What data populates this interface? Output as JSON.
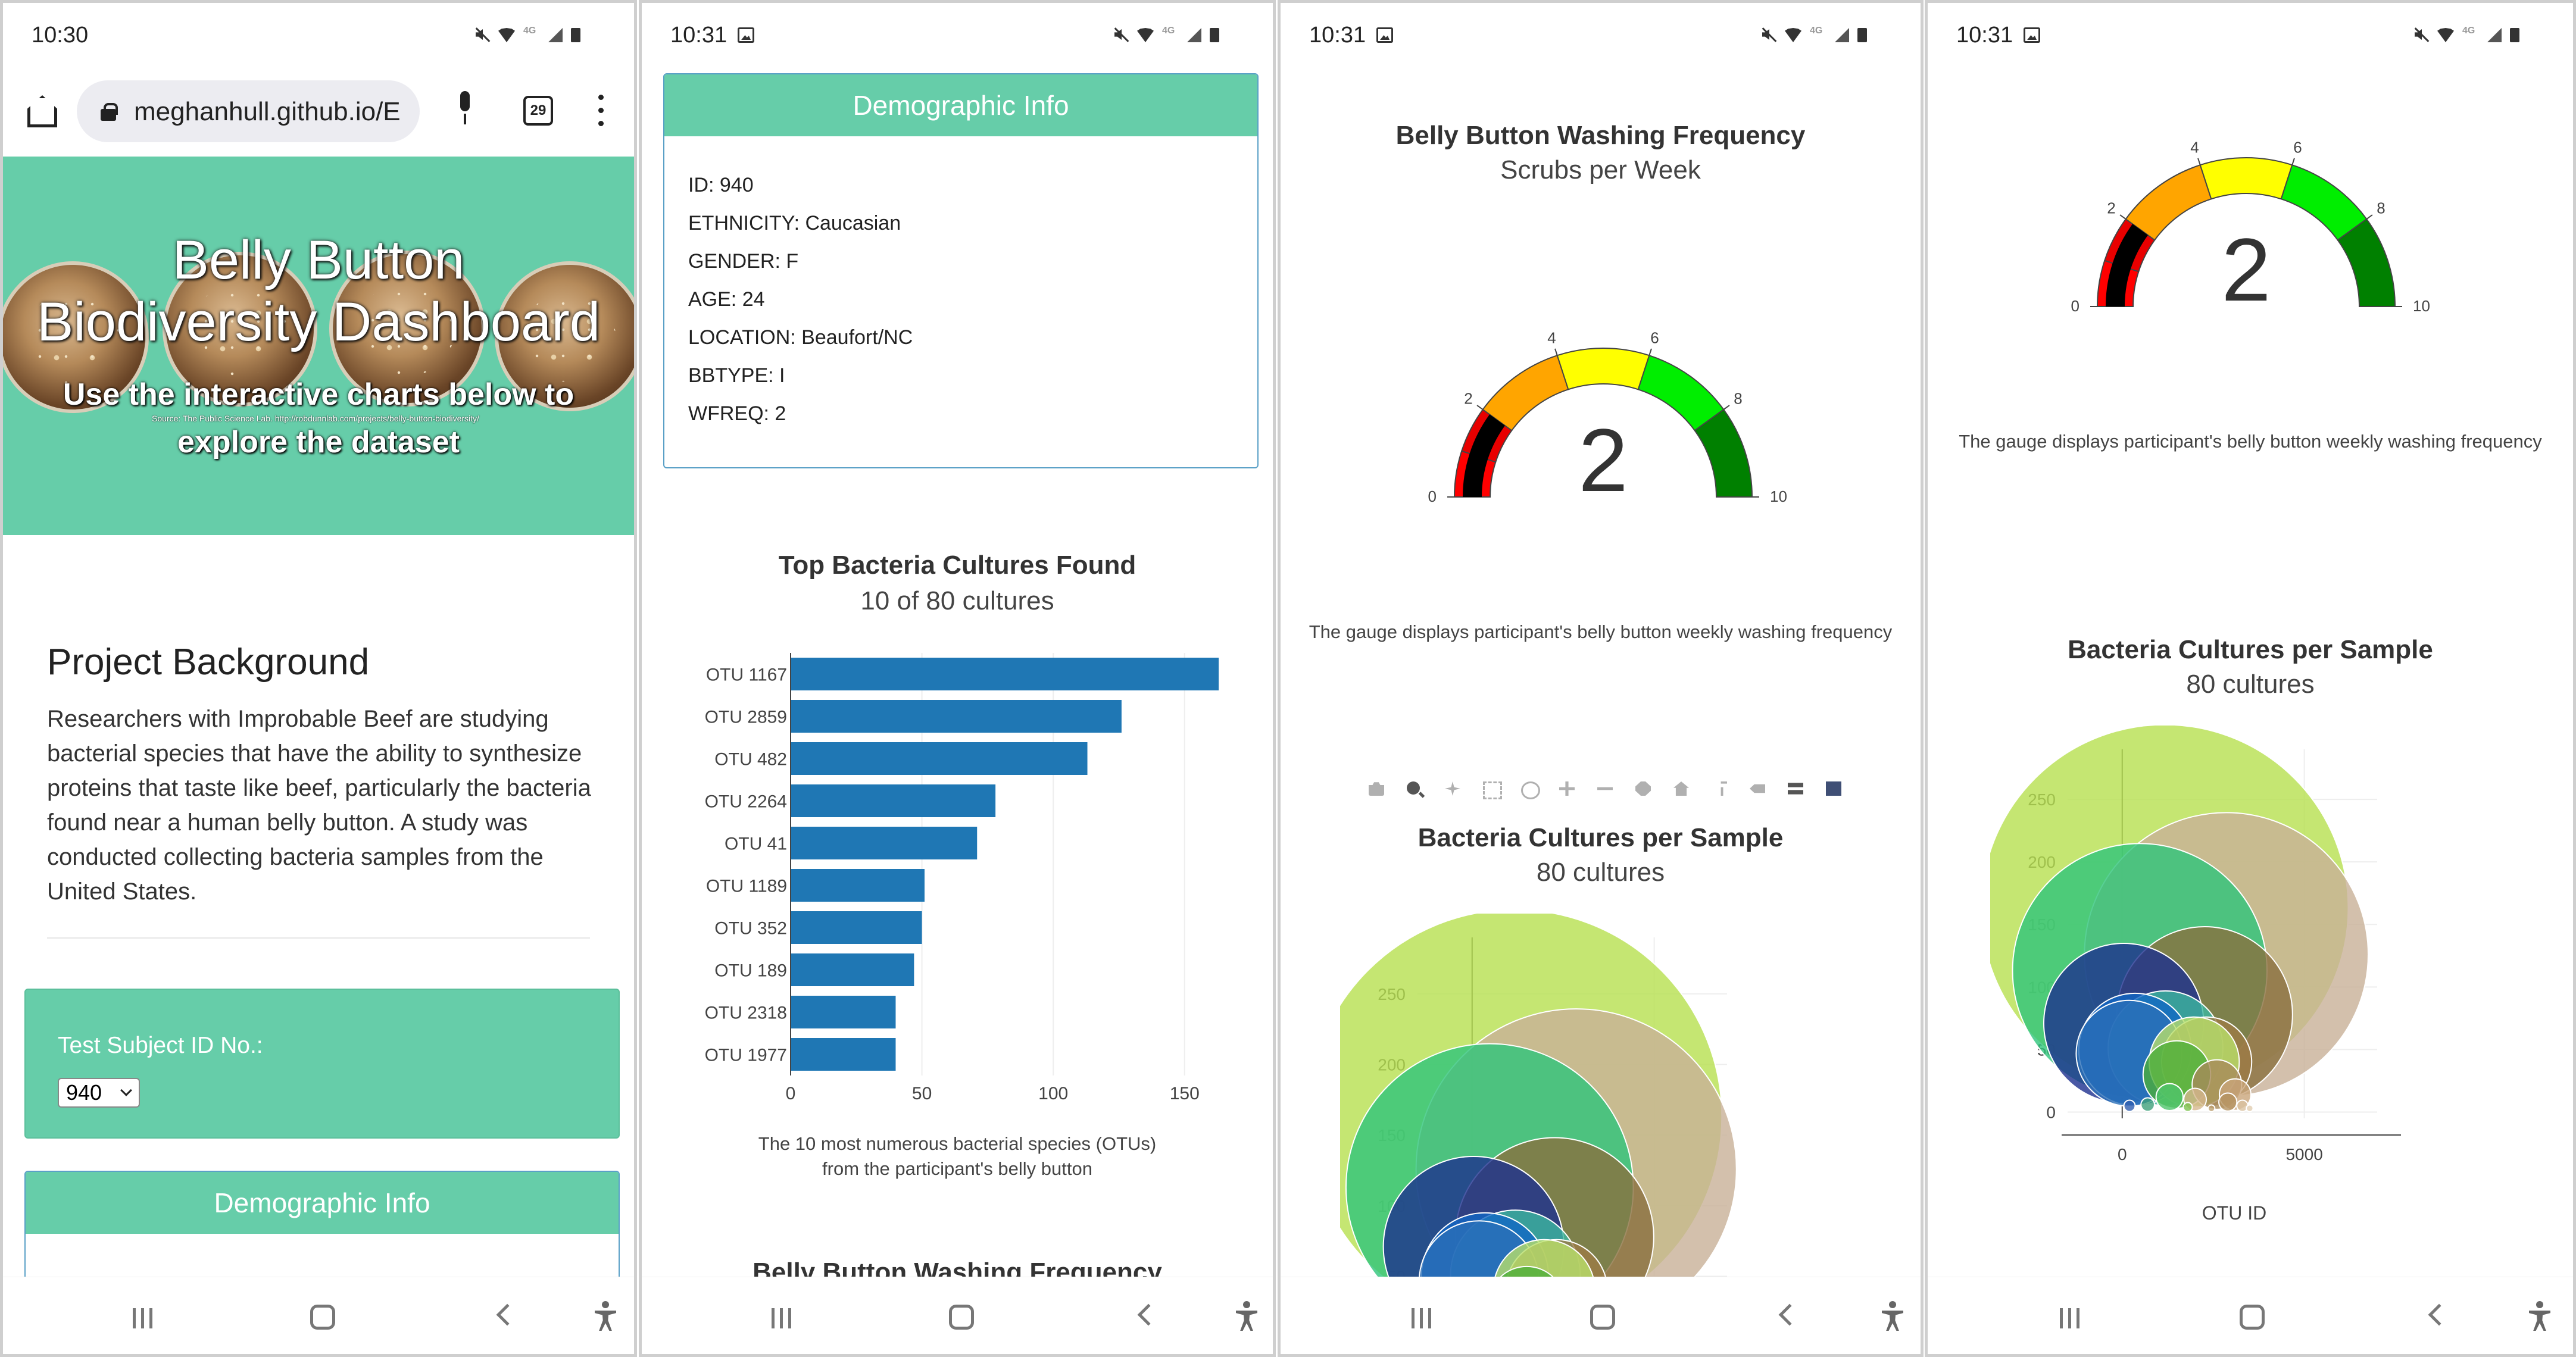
{
  "status_times": [
    "10:30",
    "10:31",
    "10:31",
    "10:31"
  ],
  "browser": {
    "url": "meghanhull.github.io/E",
    "tab_count": "29"
  },
  "hero": {
    "title_line1": "Belly Button",
    "title_line2": "Biodiversity Dashboard",
    "subtitle_line1": "Use the interactive charts below to",
    "subtitle_line2": "explore the dataset",
    "source": "Source: The Public Science Lab. http://robdunnlab.com/projects/belly-button-biodiversity/"
  },
  "background": {
    "heading": "Project Background",
    "text": "Researchers with Improbable Beef are studying bacterial species that have the ability to synthesize proteins that taste like beef, particularly the bacteria found near a human belly button. A study was conducted collecting bacteria samples from the United States."
  },
  "selector": {
    "label": "Test Subject ID No.:",
    "value": "940"
  },
  "demographic": {
    "title": "Demographic Info",
    "rows": [
      "ID: 940",
      "ETHNICITY: Caucasian",
      "GENDER: F",
      "AGE: 24",
      "LOCATION: Beaufort/NC",
      "BBTYPE: I",
      "WFREQ: 2"
    ],
    "peek": "ID: 940"
  },
  "bar": {
    "title": "Top Bacteria Cultures Found",
    "subtitle": "10 of 80 cultures",
    "caption1": "The 10 most numerous bacterial species (OTUs)",
    "caption2": "from the participant's belly button",
    "next_title": "Belly Button Washing Frequency"
  },
  "gauge": {
    "title": "Belly Button Washing Frequency",
    "subtitle": "Scrubs per Week",
    "caption": "The gauge displays participant's belly button weekly washing frequency"
  },
  "bubble": {
    "title": "Bacteria Cultures per Sample",
    "subtitle": "80 cultures",
    "xlabel": "OTU ID"
  },
  "colors": {
    "accent": "#66cda9",
    "bar": "#1f77b4",
    "card_border": "#5aa0c7"
  },
  "modebar_icons": [
    "camera-icon",
    "zoom-icon",
    "pan-icon",
    "box-select-icon",
    "lasso-icon",
    "zoom-in-icon",
    "zoom-out-icon",
    "autoscale-icon",
    "reset-axes-icon",
    "spike-lines-icon",
    "hover-closest-icon",
    "hover-compare-icon",
    "plotly-logo-icon"
  ],
  "chart_data": [
    {
      "type": "bar",
      "orientation": "horizontal",
      "categories": [
        "OTU 1167",
        "OTU 2859",
        "OTU 482",
        "OTU 2264",
        "OTU 41",
        "OTU 1189",
        "OTU 352",
        "OTU 189",
        "OTU 2318",
        "OTU 1977"
      ],
      "values": [
        163,
        126,
        113,
        78,
        71,
        51,
        50,
        47,
        40,
        40
      ],
      "xticks": [
        "0",
        "50",
        "100",
        "150"
      ],
      "xlim": [
        0,
        170
      ],
      "title": "Top Bacteria Cultures Found",
      "subtitle": "10 of 80 cultures",
      "color": "#1f77b4"
    },
    {
      "type": "gauge",
      "value": 2,
      "range": [
        0,
        10
      ],
      "ticks": [
        "0",
        "2",
        "4",
        "6",
        "8",
        "10"
      ],
      "bands": [
        {
          "from": 0,
          "to": 1,
          "color": "#ff0000"
        },
        {
          "from": 1,
          "to": 2,
          "color": "#e80000"
        },
        {
          "from": 2,
          "to": 4,
          "color": "#ffa500"
        },
        {
          "from": 4,
          "to": 6,
          "color": "#ffff00"
        },
        {
          "from": 6,
          "to": 8,
          "color": "#00ee00"
        },
        {
          "from": 8,
          "to": 10,
          "color": "#008000"
        }
      ],
      "bar_color": "#000000",
      "title": "Belly Button Washing Frequency",
      "subtitle": "Scrubs per Week"
    },
    {
      "type": "scatter",
      "mode": "bubble",
      "title": "Bacteria Cultures per Sample",
      "subtitle": "80 cultures",
      "xlabel": "OTU ID",
      "xticks": [
        "0",
        "5000"
      ],
      "yticks": [
        "0",
        "50",
        "100",
        "150",
        "200",
        "250"
      ],
      "xlim": [
        -1500,
        7000
      ],
      "ylim": [
        -5,
        290
      ],
      "points": [
        {
          "x": 1167,
          "y": 163,
          "size": 163,
          "color": "#b6e04f"
        },
        {
          "x": 2859,
          "y": 126,
          "size": 126,
          "color": "#c8b097"
        },
        {
          "x": 482,
          "y": 113,
          "size": 113,
          "color": "#2ec47a"
        },
        {
          "x": 2264,
          "y": 78,
          "size": 78,
          "color": "#8a6f3e"
        },
        {
          "x": 41,
          "y": 71,
          "size": 71,
          "color": "#1d2f8f"
        },
        {
          "x": 1189,
          "y": 51,
          "size": 51,
          "color": "#3cb6a0"
        },
        {
          "x": 352,
          "y": 50,
          "size": 50,
          "color": "#1266c4"
        },
        {
          "x": 189,
          "y": 47,
          "size": 47,
          "color": "#2b6fb8"
        },
        {
          "x": 2318,
          "y": 40,
          "size": 40,
          "color": "#9c7a45"
        },
        {
          "x": 1977,
          "y": 40,
          "size": 40,
          "color": "#b9e06a"
        },
        {
          "x": 1500,
          "y": 30,
          "size": 30,
          "color": "#4cae3a"
        },
        {
          "x": 2600,
          "y": 22,
          "size": 22,
          "color": "#a88a5a"
        },
        {
          "x": 3100,
          "y": 14,
          "size": 14,
          "color": "#c9a57a"
        },
        {
          "x": 1300,
          "y": 12,
          "size": 12,
          "color": "#4fc46b"
        },
        {
          "x": 2000,
          "y": 10,
          "size": 10,
          "color": "#d6b88e"
        },
        {
          "x": 2900,
          "y": 8,
          "size": 8,
          "color": "#b49260"
        },
        {
          "x": 700,
          "y": 6,
          "size": 6,
          "color": "#3fa07a"
        },
        {
          "x": 200,
          "y": 5,
          "size": 5,
          "color": "#2f5fb0"
        },
        {
          "x": 3300,
          "y": 5,
          "size": 5,
          "color": "#d9c2a0"
        },
        {
          "x": 1800,
          "y": 4,
          "size": 4,
          "color": "#7cc24d"
        },
        {
          "x": 2450,
          "y": 3,
          "size": 3,
          "color": "#bda070"
        },
        {
          "x": 3500,
          "y": 3,
          "size": 3,
          "color": "#e1cdb0"
        }
      ]
    }
  ]
}
